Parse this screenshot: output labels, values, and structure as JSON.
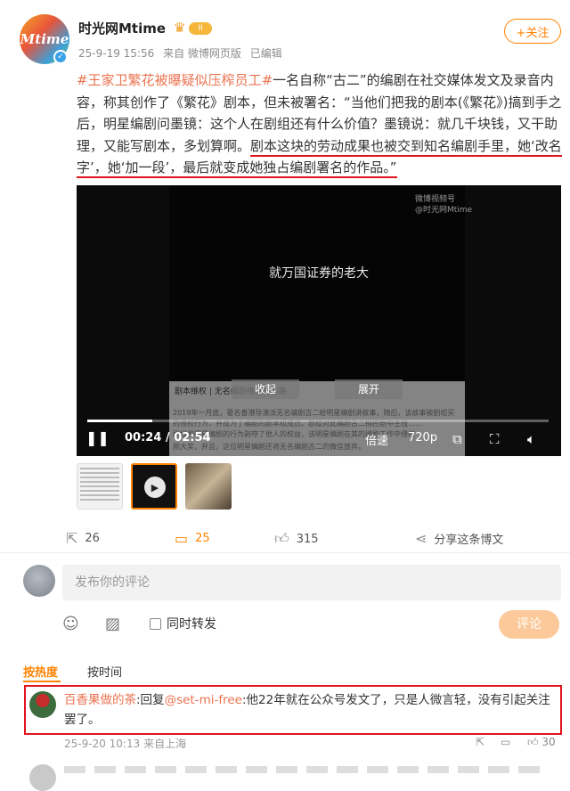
{
  "author": {
    "name": "时光网Mtime",
    "avatar_text": "Mtime",
    "level_badge": "II",
    "verified_icon": "verified-icon"
  },
  "meta": {
    "time": "25-9-19 15:56",
    "source": "来自 微博网页版",
    "edited": "已编辑"
  },
  "follow_label": "+关注",
  "post": {
    "hashtag": "#王家卫繁花被曝疑似压榨员工#",
    "text_plain": "一名自称“古二”的编剧在社交媒体发文及录音内容，称其创作了《繁花》剧本，但未被署名：“当他们把我的剧本(《繁花》)搞到手之后，明星编剧问墨镜：这个人在剧组还有什么价值？墨镜说：就几千块钱，又干助理，又能写剧本，多划算啊。",
    "text_underlined": "剧本这块的劳动成果也被交到知名编剧手里，她‘改名字’，她‘加一段’，最后就变成她独占编剧署名的作品。”"
  },
  "video": {
    "subtitle": "就万国证券的老大",
    "watermark_line1": "微博视频号",
    "watermark_line2": "@时光网Mtime",
    "doc_heading": "剧本维权 | 无名编剧维权的心路",
    "doc_line1": "2019年一月底，著名香港导演派无名编剧古二给明星编剧讲故事，随后，该故事被剧组买",
    "doc_line2": "的侵权行为，并成为了编剧的剧本组成员。剧组对此编剧古二指控剧中主线……",
    "doc_line3": "剧组和明星编剧的行为剥夺了他人的权益，该明星编剧在其的编剧工作中侵权",
    "doc_line4": "剧大奖，并且，这位明星编剧还将无名编剧古二的微信放弃。",
    "collapse_label": "收起",
    "expand_label": "展开",
    "current_time": "00:24",
    "duration": "02:54",
    "progress": 0.14,
    "speed_label": "倍速",
    "quality_label": "720p"
  },
  "actions": {
    "share_count": "26",
    "comment_count": "25",
    "like_count": "315",
    "share_friends_label": "分享这条博文"
  },
  "composer": {
    "placeholder": "发布你的评论",
    "repost_label": "同时转发",
    "submit_label": "评论"
  },
  "sort": {
    "hot_label": "按热度",
    "time_label": "按时间"
  },
  "comment": {
    "name": "百香果做的茶",
    "reply_prefix": ":回复",
    "mention": "@set-mi-free",
    "text": ":他22年就在公众号发文了，只是人微言轻，没有引起关注罢了。",
    "time": "25-9-20 10:13",
    "location": "来自上海",
    "like_count": "30"
  },
  "colors": {
    "accent_orange": "#ff8200",
    "link_orange": "#eb7350",
    "highlight_red": "#e0141e"
  }
}
